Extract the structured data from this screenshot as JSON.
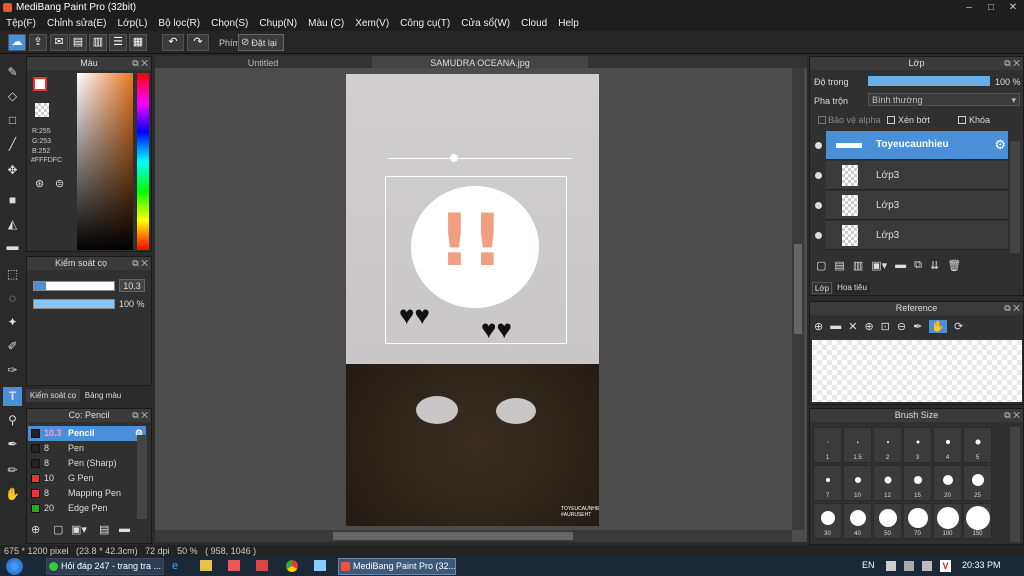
{
  "window": {
    "title": "MediBang Paint Pro (32bit)"
  },
  "menu": [
    "Tệp(F)",
    "Chỉnh sửa(E)",
    "Lớp(L)",
    "Bộ lọc(R)",
    "Chọn(S)",
    "Chụp(N)",
    "Màu (C)",
    "Xem(V)",
    "Công cụ(T)",
    "Cửa sổ(W)",
    "Cloud",
    "Help"
  ],
  "toolbar": {
    "phim_label": "Phím",
    "reset_label": "Đặt lại"
  },
  "tabs": [
    "Untitled",
    "SAMUDRA OCEANA.jpg"
  ],
  "color_panel": {
    "title": "Màu",
    "rgb_r": "R:255",
    "rgb_g": "G:253",
    "rgb_b": "B:252",
    "hex": "#FFFDFC"
  },
  "brush_control": {
    "title": "Kiểm soát cọ",
    "size_value": "10.3",
    "opacity_value": "100 %",
    "size_fill": 0.15,
    "opacity_fill": 1.0
  },
  "left_tabs": {
    "brush_control": "Kiểm soát cọ",
    "palette": "Bảng màu"
  },
  "brush_list": {
    "title": "Cọ: Pencil",
    "items": [
      {
        "size": "10.3",
        "name": "Pencil",
        "color": "#222"
      },
      {
        "size": "8",
        "name": "Pen",
        "color": "#222"
      },
      {
        "size": "8",
        "name": "Pen (Sharp)",
        "color": "#222"
      },
      {
        "size": "10",
        "name": "G Pen",
        "color": "#e33"
      },
      {
        "size": "8",
        "name": "Mapping Pen",
        "color": "#e33"
      },
      {
        "size": "20",
        "name": "Edge Pen",
        "color": "#2a2"
      }
    ]
  },
  "layer_panel": {
    "title": "Lớp",
    "opacity_label": "Độ trong",
    "opacity_value": "100 %",
    "opacity_fill": 1.0,
    "blend_label": "Pha trộn",
    "blend_value": "Bình thường",
    "protect_alpha": "Bảo vệ alpha",
    "clip": "Xén bớt",
    "lock": "Khóa",
    "layers": [
      "Toyeucaunhieu",
      "Lớp3",
      "Lớp3",
      "Lớp3"
    ],
    "tab_layer": "Lớp",
    "tab_nav": "Hoa tiêu"
  },
  "reference_panel": {
    "title": "Reference"
  },
  "brush_size_panel": {
    "title": "Brush Size",
    "sizes": [
      "1",
      "1.5",
      "2",
      "3",
      "4",
      "5",
      "7",
      "10",
      "12",
      "15",
      "20",
      "25",
      "30",
      "40",
      "50",
      "70",
      "100",
      "150"
    ]
  },
  "canvas": {
    "watermark": "TOYEUCAUNHIEU\n#AURUSEHT"
  },
  "status": {
    "text": "675 * 1200 pixel   (23.8 * 42.3cm)   72 dpi   50 %   ( 958, 1046 )"
  },
  "taskbar": {
    "item1": "Hỏi đáp 247 - trang tra ...",
    "item2": "MediBang Paint Pro (32...",
    "lang": "EN",
    "time": "20:33 PM"
  },
  "colors": {
    "accent": "#4a90d9",
    "selected_layer": "#4a90d9"
  }
}
